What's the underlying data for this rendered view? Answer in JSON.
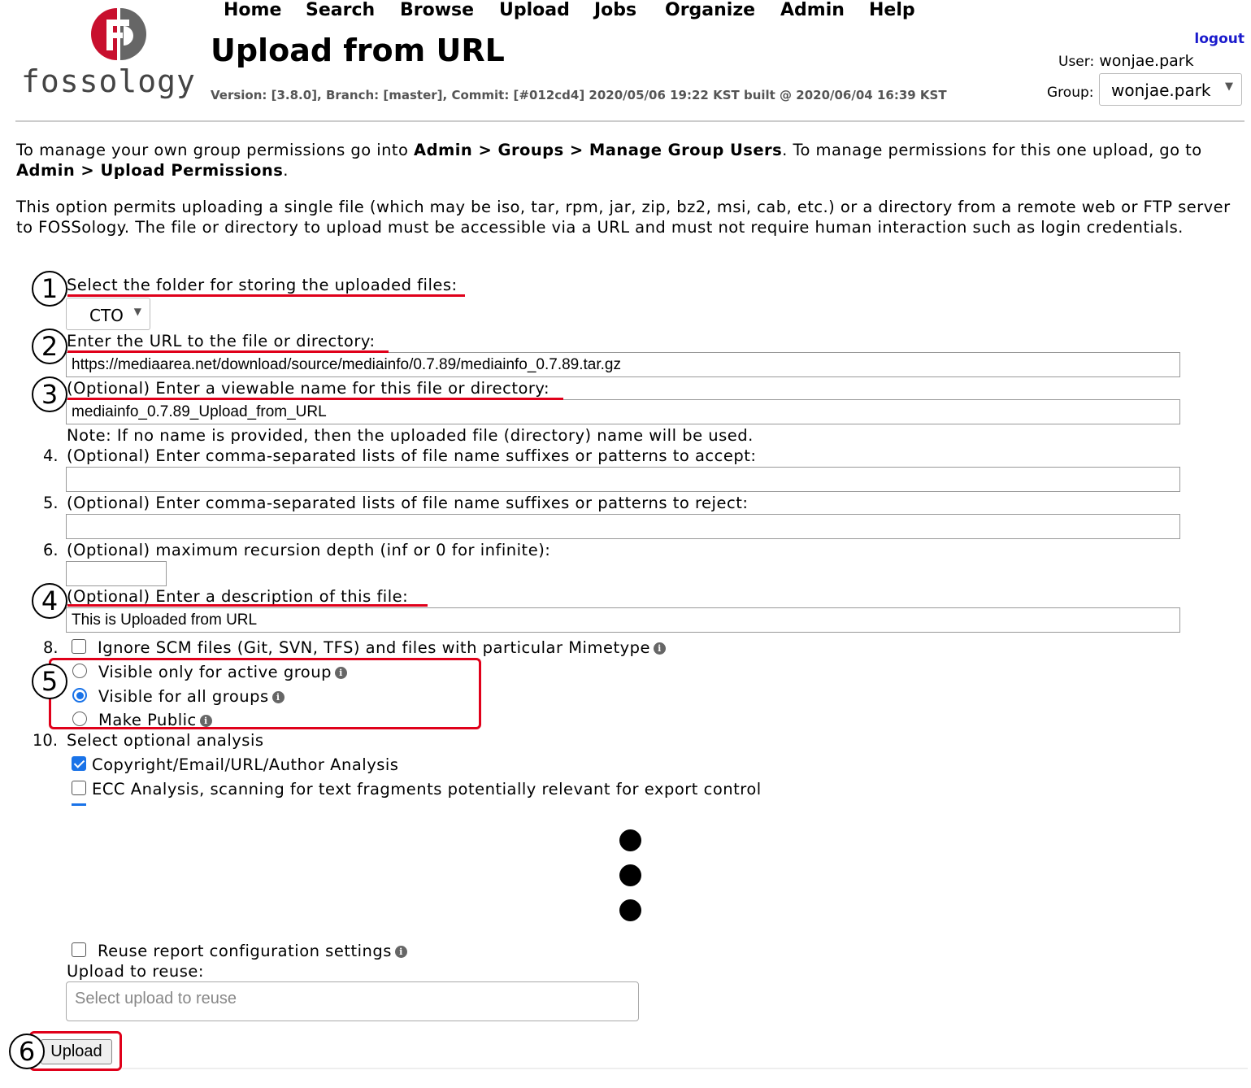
{
  "nav": {
    "logo_text": "fossology",
    "items": [
      "Home",
      "Search",
      "Browse",
      "Upload",
      "Jobs",
      "Organize",
      "Admin",
      "Help"
    ]
  },
  "header": {
    "title": "Upload from URL",
    "version_line": "Version: [3.8.0], Branch: [master], Commit: [#012cd4] 2020/05/06 19:22 KST built @ 2020/06/04 16:39 KST",
    "logout": "logout",
    "user_label": "User:",
    "user_name": "wonjae.park",
    "group_label": "Group:",
    "group_value": "wonjae.park"
  },
  "intro": {
    "p1_a": "To manage your own group permissions go into ",
    "p1_b": "Admin > Groups > Manage Group Users",
    "p1_c": ". To manage permissions for this one upload, go to ",
    "p1_d": "Admin > Upload Permissions",
    "p1_e": ".",
    "p2": "This option permits uploading a single file (which may be iso, tar, rpm, jar, zip, bz2, msi, cab, etc.) or a directory from a remote web or FTP server to FOSSology. The file or directory to upload must be accessible via a URL and must not require human interaction such as login credentials."
  },
  "form": {
    "folder_label": "Select the folder for storing the uploaded files:",
    "folder_value": "CTO",
    "url_label": "Enter the URL to the file or directory:",
    "url_value": "https://mediaarea.net/download/source/mediainfo/0.7.89/mediainfo_0.7.89.tar.gz",
    "name_label": "(Optional) Enter a viewable name for this file or directory:",
    "name_value": "mediainfo_0.7.89_Upload_from_URL",
    "name_note": "Note: If no name is provided, then the uploaded file (directory) name will be used.",
    "step4_num": "4.",
    "accept_label": "(Optional) Enter comma-separated lists of file name suffixes or patterns to accept:",
    "step5_num": "5.",
    "reject_label": "(Optional) Enter comma-separated lists of file name suffixes or patterns to reject:",
    "step6_num": "6.",
    "depth_label": "(Optional) maximum recursion depth (inf or 0 for infinite):",
    "desc_label": "(Optional) Enter a description of this file:",
    "desc_value": "This is Uploaded from URL",
    "step8_num": "8.",
    "ignore_scm_label": "Ignore SCM files (Git, SVN, TFS) and files with particular Mimetype",
    "visibility_options": [
      "Visible only for active group",
      "Visible for all groups",
      "Make Public"
    ],
    "visibility_selected": 1,
    "step10_num": "10.",
    "analysis_label": "Select optional analysis",
    "analysis_options": [
      {
        "label": "Copyright/Email/URL/Author Analysis",
        "checked": true
      },
      {
        "label": "ECC Analysis, scanning for text fragments potentially relevant for export control",
        "checked": false
      }
    ],
    "reuse_report_label": "Reuse report configuration settings",
    "reuse_label": "Upload to reuse:",
    "reuse_placeholder": "Select upload to reuse",
    "upload_button": "Upload"
  },
  "annotations": [
    "1",
    "2",
    "3",
    "4",
    "5",
    "6"
  ],
  "colors": {
    "annotation_red": "#e0001a",
    "link_blue": "#1a1acc",
    "check_blue": "#1a73e8"
  }
}
